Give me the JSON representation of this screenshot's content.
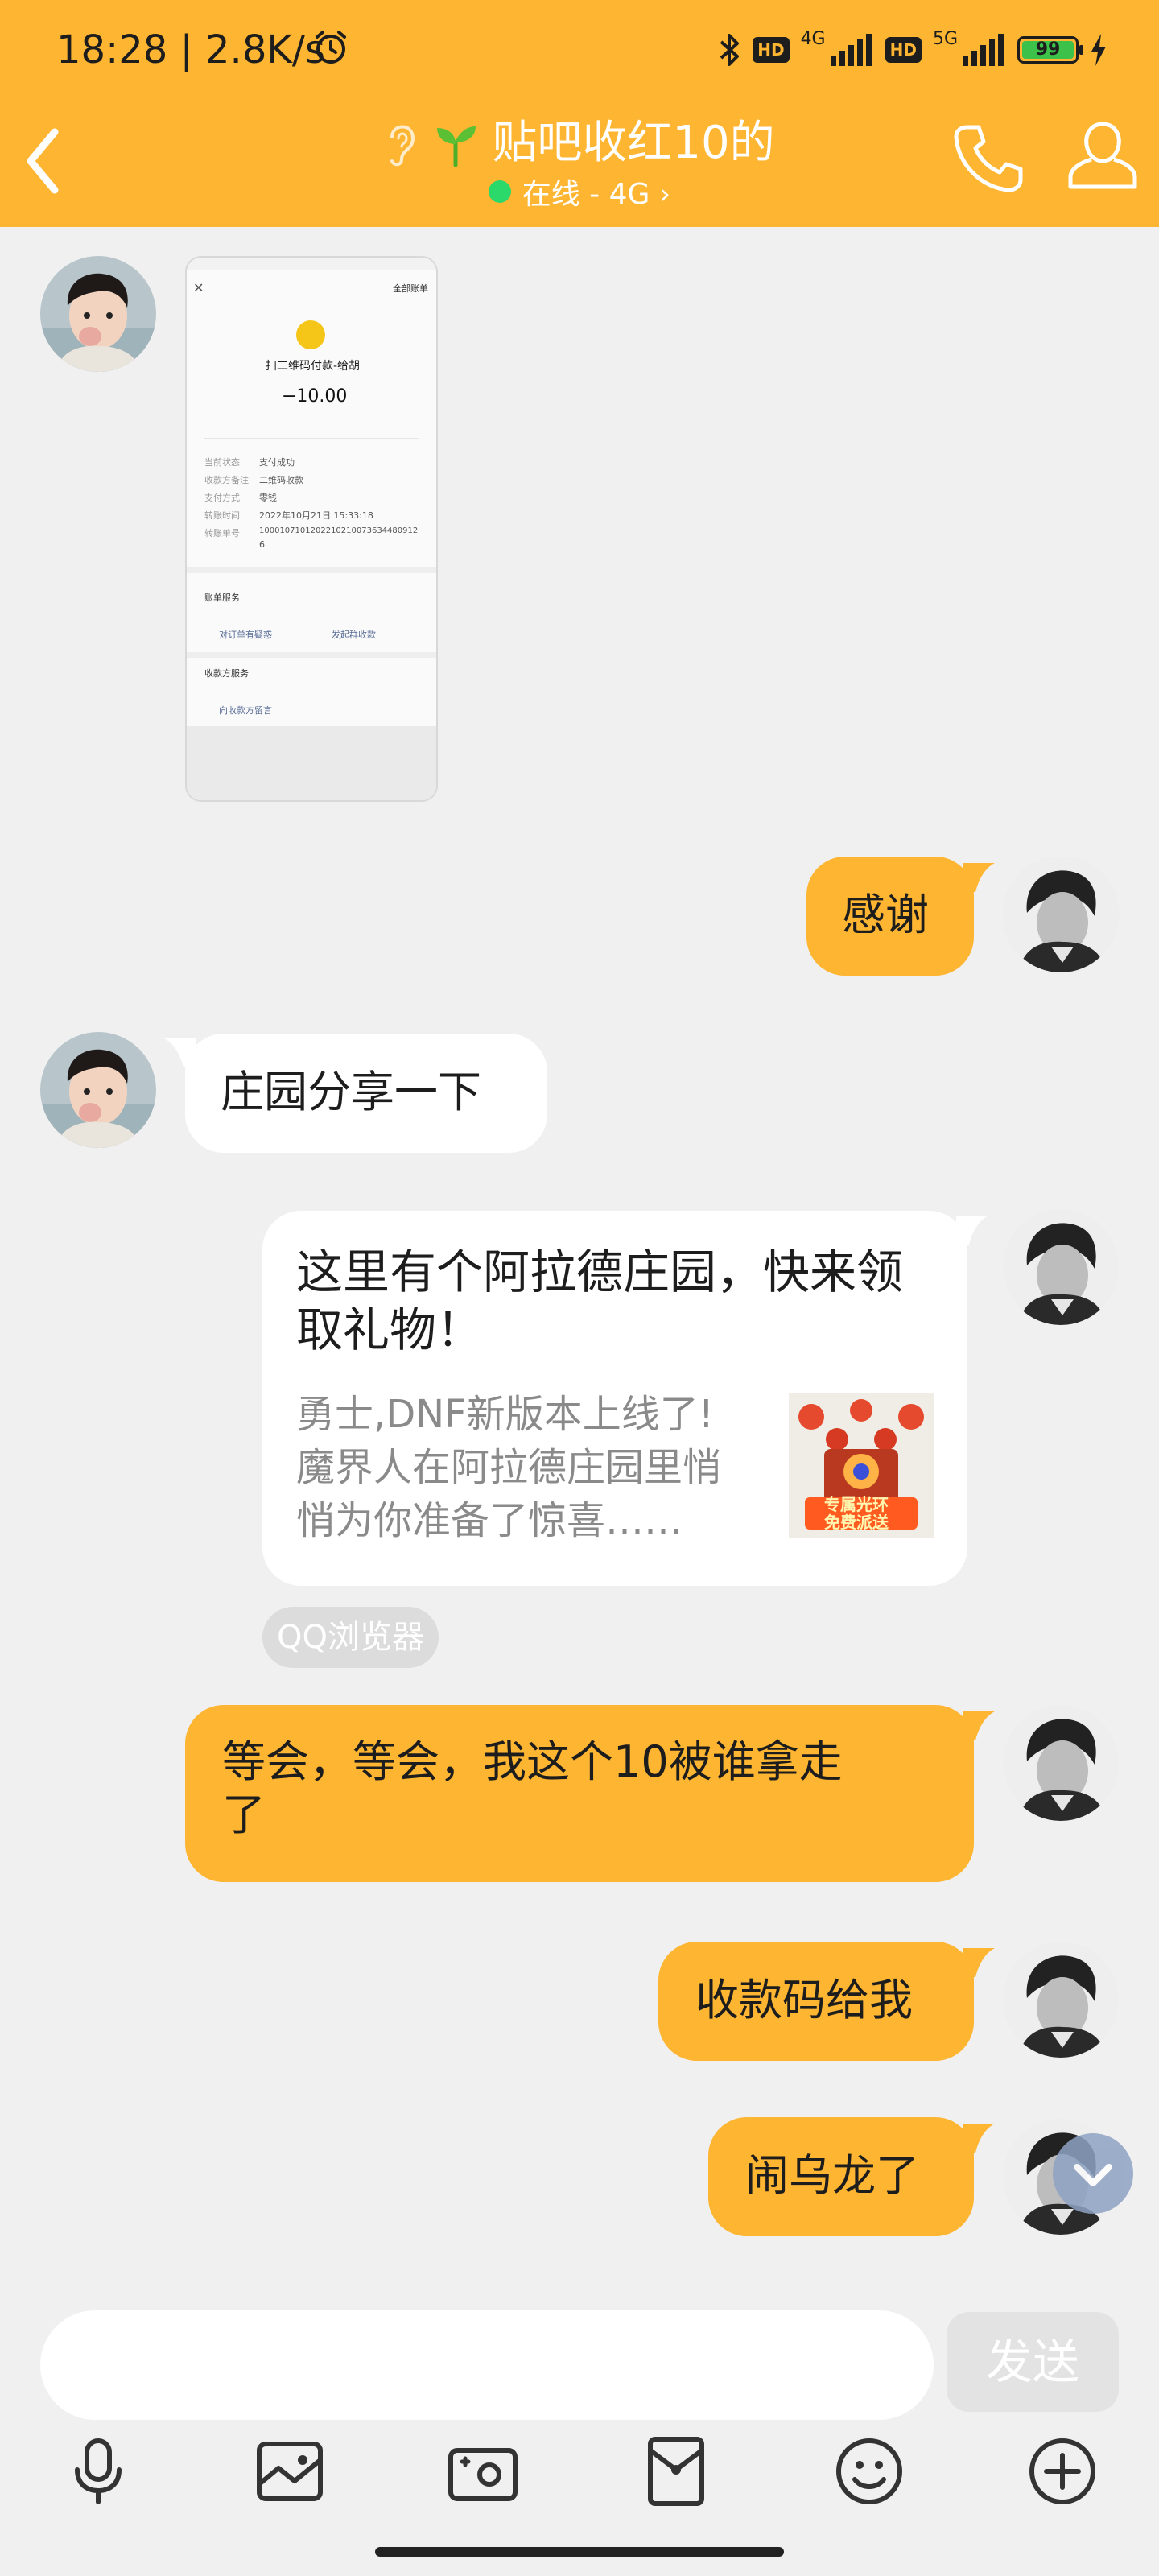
{
  "status_bar": {
    "time": "18:28 | 2.8K/s",
    "network1": "4G",
    "network2": "5G",
    "hd_label": "HD",
    "battery": "99"
  },
  "header": {
    "title": "贴吧收红10的",
    "status": "在线 - 4G ›"
  },
  "payment_screenshot": {
    "top_right": "全部账单",
    "title": "扫二维码付款-给胡",
    "amount": "−10.00",
    "rows": [
      {
        "label": "当前状态",
        "value": "支付成功"
      },
      {
        "label": "收款方备注",
        "value": "二维码收款"
      },
      {
        "label": "支付方式",
        "value": "零钱"
      },
      {
        "label": "转账时间",
        "value": "2022年10月21日 15:33:18"
      },
      {
        "label": "转账单号",
        "value": "1000107101202210210073634480912"
      },
      {
        "label": "",
        "value": "6"
      }
    ],
    "section1": "账单服务",
    "action1": "对订单有疑惑",
    "action2": "发起群收款",
    "section2": "收款方服务",
    "action3": "向收款方留言"
  },
  "messages": {
    "m1": "感谢",
    "m2": "庄园分享一下",
    "m4": "等会，等会，我这个10被谁拿走",
    "m4b": "了",
    "m5": "收款码给我",
    "m6": "闹乌龙了"
  },
  "link_card": {
    "title": "这里有个阿拉德庄园，快来领",
    "title2": "取礼物！",
    "desc1": "勇士,DNF新版本上线了!",
    "desc2": "魔界人在阿拉德庄园里悄",
    "desc3": "悄为你准备了惊喜……",
    "thumb_text1": "专属光环",
    "thumb_text2": "免费派送",
    "source": "QQ浏览器"
  },
  "input": {
    "send_label": "发送"
  },
  "colors": {
    "accent": "#fdb532",
    "background": "#f0f0f0",
    "online": "#2bd86a"
  },
  "icons": [
    "alarm-icon",
    "bluetooth-icon",
    "signal-icon",
    "battery-icon",
    "back-icon",
    "ear-icon",
    "sprout-icon",
    "phone-icon",
    "profile-icon",
    "chevron-down-icon",
    "microphone-icon",
    "image-icon",
    "camera-icon",
    "red-packet-icon",
    "emoji-icon",
    "plus-icon"
  ]
}
